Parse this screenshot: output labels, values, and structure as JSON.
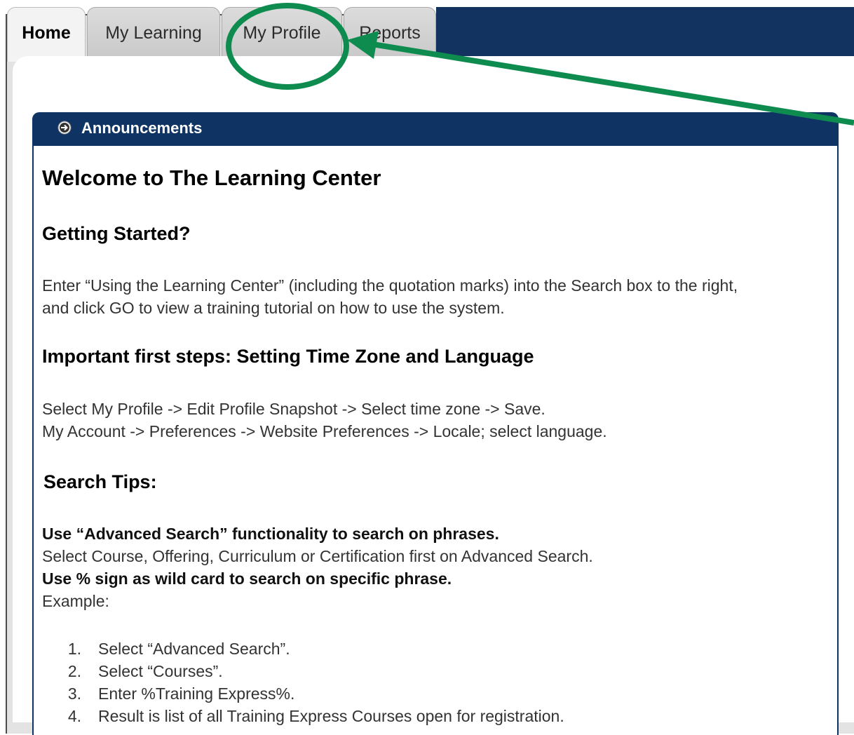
{
  "tabs": [
    {
      "label": "Home",
      "active": true
    },
    {
      "label": "My Learning",
      "active": false
    },
    {
      "label": "My Profile",
      "active": false
    },
    {
      "label": "Reports",
      "active": false
    }
  ],
  "panel": {
    "title": "Announcements",
    "icon": "arrow-circle-icon"
  },
  "content": {
    "welcome_heading": "Welcome to The Learning Center",
    "getting_started_heading": "Getting Started?",
    "getting_started_line1": "Enter “Using the Learning Center” (including the quotation marks) into the Search box to the right,",
    "getting_started_line2": "and click GO to view a training tutorial on how to use the system.",
    "first_steps_heading": "Important first steps: Setting Time Zone and Language",
    "first_steps_line1": "Select My Profile -> Edit Profile Snapshot -> Select time zone -> Save.",
    "first_steps_line2": "My Account -> Preferences -> Website Preferences -> Locale; select language.",
    "search_tips_heading": "Search Tips:",
    "tip1_bold": "Use “Advanced Search” functionality to search on phrases.",
    "tip1_text": "Select Course, Offering, Curriculum or Certification first on Advanced Search.",
    "tip2_bold": "Use % sign as wild card to search on specific phrase.",
    "example_label": "Example:",
    "steps": [
      {
        "num": "1.",
        "text": "Select “Advanced Search”."
      },
      {
        "num": "2.",
        "text": "Select “Courses”."
      },
      {
        "num": "3.",
        "text": "Enter %Training Express%."
      },
      {
        "num": "4.",
        "text": "Result is list of all Training Express Courses open for registration."
      }
    ]
  },
  "annotation": {
    "color": "#0e8c4f",
    "target": "My Profile"
  },
  "colors": {
    "navy": "#0f3363",
    "tab_bg": "#d4d4d4",
    "page_bg": "#e3e3e3"
  }
}
